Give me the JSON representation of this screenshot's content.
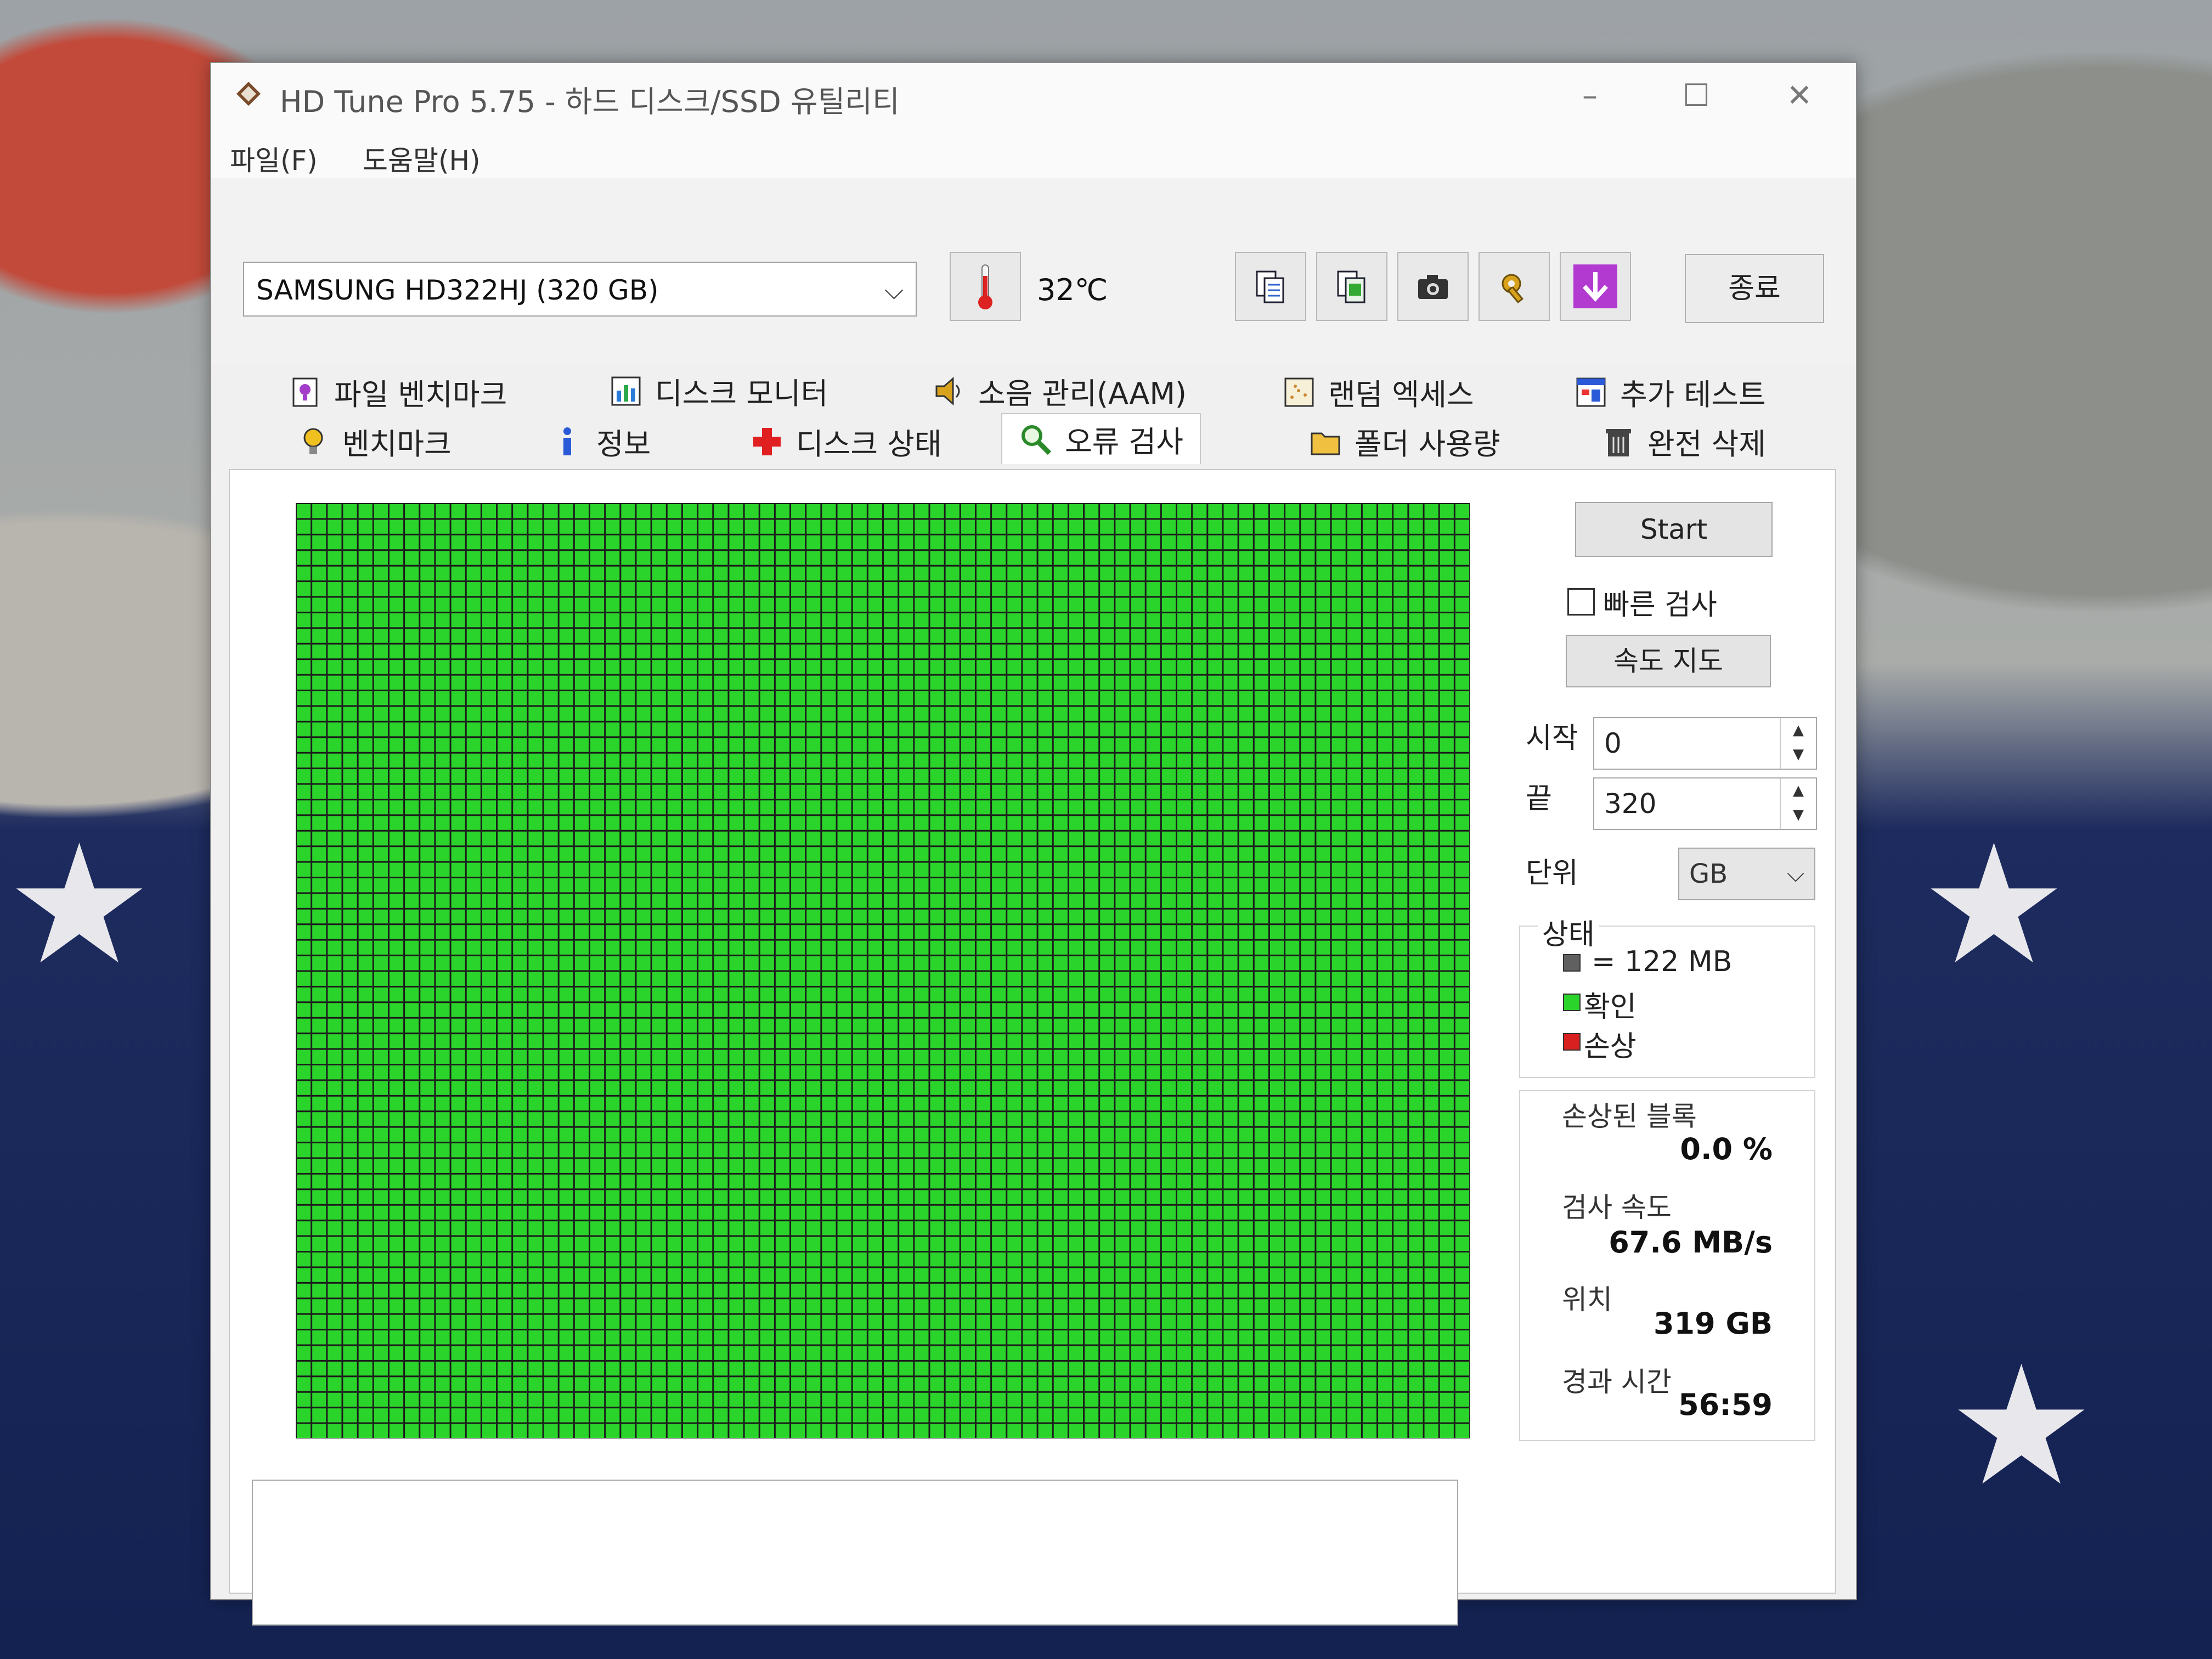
{
  "window": {
    "title": "HD Tune Pro 5.75 - 하드 디스크/SSD 유틸리티"
  },
  "menu": {
    "file": "파일(F)",
    "help": "도움말(H)"
  },
  "toolbar": {
    "drive": "SAMSUNG HD322HJ (320 GB)",
    "temperature": "32℃",
    "exit_label": "종료",
    "icons": [
      "copy-text-icon",
      "copy-info-icon",
      "screenshot-camera-icon",
      "options-wrench-icon",
      "save-download-icon"
    ]
  },
  "tabs": {
    "row1": [
      "파일 벤치마크",
      "디스크 모니터",
      "소음 관리(AAM)",
      "랜덤 엑세스",
      "추가 테스트"
    ],
    "row2": [
      "벤치마크",
      "정보",
      "디스크 상태",
      "오류 검사",
      "폴더 사용량",
      "완전 삭제"
    ],
    "active": "오류 검사"
  },
  "scan": {
    "start_label": "Start",
    "quick_scan_label": "빠른 검사",
    "quick_scan_checked": false,
    "speed_map_label": "속도 지도",
    "start_field_label": "시작",
    "start_value": "0",
    "end_field_label": "끝",
    "end_value": "320",
    "unit_label": "단위",
    "unit_value": "GB"
  },
  "legend": {
    "title": "상태",
    "block_size": "= 122 MB",
    "ok": "확인",
    "damaged": "손상",
    "colors": {
      "block": "#606060",
      "ok": "#2bd42b",
      "damaged": "#d82020"
    }
  },
  "stats": {
    "damaged_blocks_label": "손상된 블록",
    "damaged_blocks_value": "0.0 %",
    "scan_speed_label": "검사 속도",
    "scan_speed_value": "67.6 MB/s",
    "position_label": "위치",
    "position_value": "319 GB",
    "elapsed_label": "경과 시간",
    "elapsed_value": "56:59"
  },
  "block_map": {
    "columns": 76,
    "rows": 60,
    "ok_fraction": 1.0
  }
}
